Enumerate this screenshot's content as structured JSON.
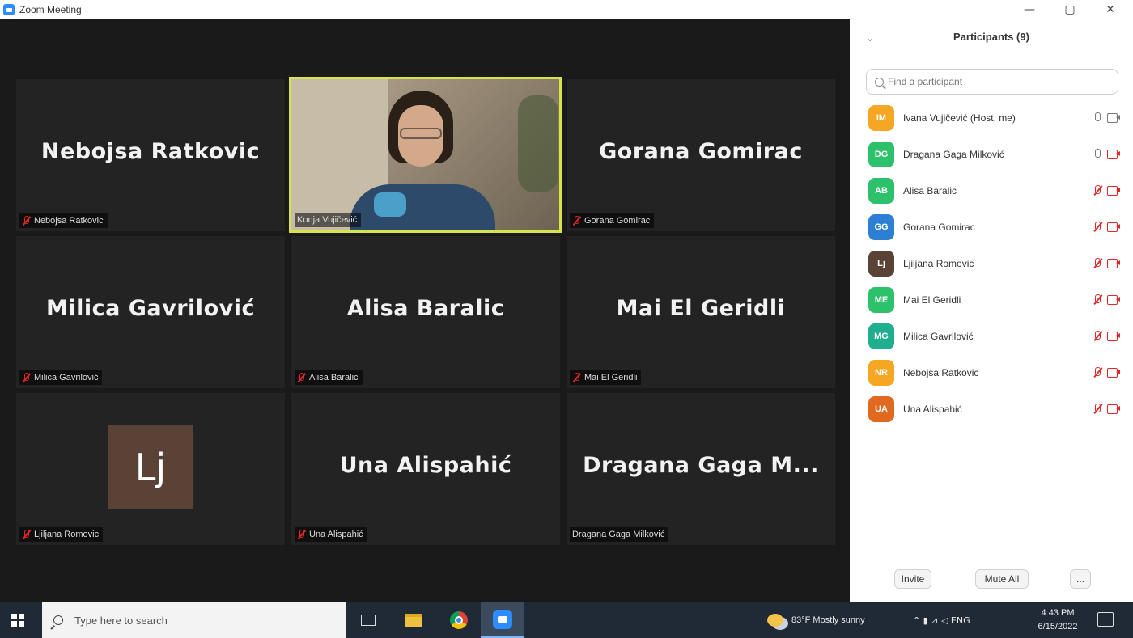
{
  "window": {
    "title": "Zoom Meeting",
    "minimize": "—",
    "maximize": "▢",
    "close": "✕"
  },
  "tiles": [
    {
      "display": "Nebojsa Ratkovic",
      "label": "Nebojsa Ratkovic",
      "muted": true
    },
    {
      "display": "",
      "label": "Konja Vujičević",
      "muted": false,
      "video": true
    },
    {
      "display": "Gorana Gomirac",
      "label": "Gorana Gomirac",
      "muted": true
    },
    {
      "display": "Milica Gavrilović",
      "label": "Milica Gavrilović",
      "muted": true
    },
    {
      "display": "Alisa Baralic",
      "label": "Alisa Baralic",
      "muted": true
    },
    {
      "display": "Mai El Geridli",
      "label": "Mai El Geridli",
      "muted": true
    },
    {
      "display": "Lj",
      "label": "Ljiljana Romovic",
      "muted": true,
      "avatar": true
    },
    {
      "display": "Una Alispahić",
      "label": "Una Alispahić",
      "muted": true
    },
    {
      "display": "Dragana Gaga M...",
      "label": "Dragana Gaga Milković",
      "muted": false
    }
  ],
  "panel": {
    "title": "Participants (9)",
    "collapse": "⌄",
    "search_placeholder": "Find a participant",
    "participants": [
      {
        "initials": "IM",
        "name": "Ivana Vujičević (Host, me)",
        "color": "#f5a623",
        "muted": false,
        "video": true
      },
      {
        "initials": "DG",
        "name": "Dragana Gaga Milković",
        "color": "#2ec16b",
        "muted": false,
        "video": false
      },
      {
        "initials": "AB",
        "name": "Alisa Baralic",
        "color": "#2ec16b",
        "muted": true,
        "video": false
      },
      {
        "initials": "GG",
        "name": "Gorana Gomirac",
        "color": "#2d7fd3",
        "muted": true,
        "video": false
      },
      {
        "initials": "Lj",
        "name": "Ljiljana Romovic",
        "color": "#5b4236",
        "muted": true,
        "video": false
      },
      {
        "initials": "ME",
        "name": "Mai El Geridli",
        "color": "#2ec16b",
        "muted": true,
        "video": false
      },
      {
        "initials": "MG",
        "name": "Milica Gavrilović",
        "color": "#1fae8e",
        "muted": true,
        "video": false
      },
      {
        "initials": "NR",
        "name": "Nebojsa Ratkovic",
        "color": "#f5a623",
        "muted": true,
        "video": false
      },
      {
        "initials": "UA",
        "name": "Una Alispahić",
        "color": "#e0681f",
        "muted": true,
        "video": false
      }
    ],
    "invite_label": "Invite",
    "mute_all_label": "Mute All",
    "more_label": "..."
  },
  "taskbar": {
    "search_text": "Type here to search",
    "weather": "83°F Mostly sunny",
    "tray_icons": "^  ▮  ⊿  ◁  ENG",
    "time": "4:43 PM",
    "date": "6/15/2022"
  }
}
